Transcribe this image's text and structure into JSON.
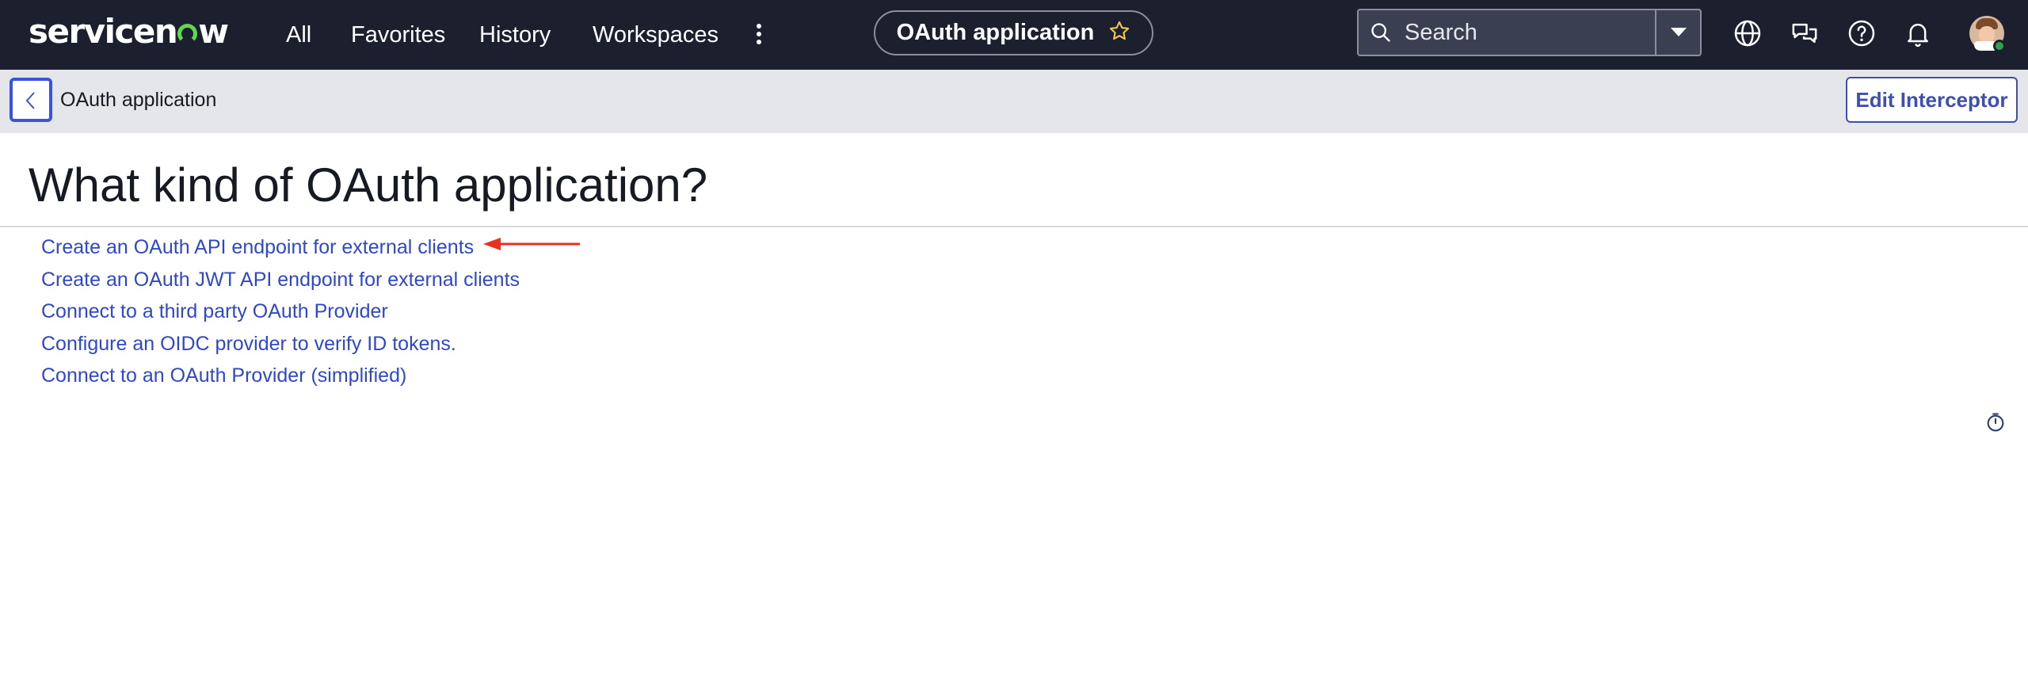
{
  "topnav": {
    "logo_text": "servicenow",
    "items": [
      {
        "label": "All"
      },
      {
        "label": "Favorites"
      },
      {
        "label": "History"
      },
      {
        "label": "Workspaces"
      }
    ],
    "more_icon": "vertical-ellipsis-icon",
    "app_pill": {
      "label": "OAuth application",
      "icon": "star-outline-icon",
      "star_color": "#f2c94c"
    },
    "search": {
      "placeholder": "Search",
      "value": ""
    },
    "icons": [
      "globe-icon",
      "chat-bubbles-icon",
      "help-icon",
      "bell-icon"
    ],
    "avatar": {
      "presence": "online",
      "presence_color": "#2ea04a"
    },
    "background": "#1c1f2e"
  },
  "subheader": {
    "back_icon": "chevron-left-icon",
    "title": "OAuth application",
    "edit_button": "Edit Interceptor"
  },
  "main": {
    "heading": "What kind of OAuth application?",
    "options": [
      {
        "label": "Create an OAuth API endpoint for external clients"
      },
      {
        "label": "Create an OAuth JWT API endpoint for external clients"
      },
      {
        "label": "Connect to a third party OAuth Provider"
      },
      {
        "label": "Configure an OIDC provider to verify ID tokens."
      },
      {
        "label": "Connect to an OAuth Provider (simplified)"
      }
    ],
    "annotation": {
      "type": "arrow",
      "points_to_option": 0,
      "color": "#e8321e"
    },
    "timer_icon": "stopwatch-icon",
    "link_color": "#2f48c9"
  },
  "colors": {
    "accent": "#3c53e0",
    "brand_green": "#62d84e",
    "subheader_bg": "#e5e6ea"
  }
}
